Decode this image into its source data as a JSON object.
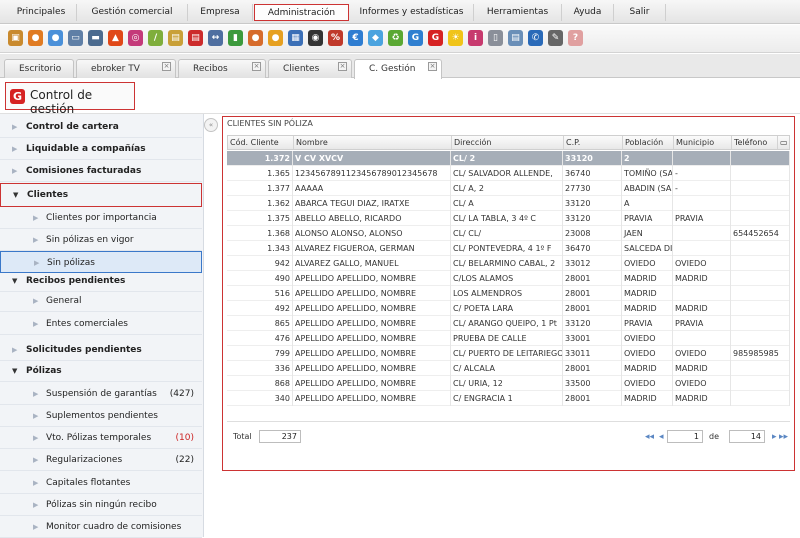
{
  "menu": [
    "Principales",
    "Gestión comercial",
    "Empresa",
    "Administración",
    "Informes y estadísticas",
    "Herramientas",
    "Ayuda",
    "Salir"
  ],
  "tabs": [
    "Escritorio",
    "ebroker TV",
    "Recibos",
    "Clientes",
    "C. Gestión"
  ],
  "page_title": "Control de gestión",
  "sidebar": {
    "items": [
      {
        "label": "Control de cartera"
      },
      {
        "label": "Liquidable a compañías"
      },
      {
        "label": "Comisiones facturadas"
      },
      {
        "label": "Clientes"
      },
      {
        "label": "Clientes por importancia"
      },
      {
        "label": "Sin pólizas en vigor"
      },
      {
        "label": "Sin pólizas"
      },
      {
        "label": "Recibos pendientes"
      },
      {
        "label": "General"
      },
      {
        "label": "Entes comerciales"
      },
      {
        "label": "Solicitudes pendientes"
      },
      {
        "label": "Pólizas"
      },
      {
        "label": "Suspensión de garantías",
        "count": "(427)"
      },
      {
        "label": "Suplementos pendientes"
      },
      {
        "label": "Vto. Pólizas temporales",
        "count": "(10)"
      },
      {
        "label": "Regularizaciones",
        "count": "(22)"
      },
      {
        "label": "Capitales flotantes"
      },
      {
        "label": "Pólizas sin ningún recibo"
      },
      {
        "label": "Monitor cuadro de comisiones"
      }
    ]
  },
  "grid": {
    "title": "CLIENTES SIN PÓLIZA",
    "columns": [
      "Cód. Cliente",
      "Nombre",
      "Dirección",
      "C.P.",
      "Población",
      "Municipio",
      "Teléfono"
    ],
    "rows": [
      [
        "1.372",
        "V CV XVCV",
        "CL/ 2",
        "33120",
        "2",
        "",
        ""
      ],
      [
        "1.365",
        "1234567891123456789012345678",
        "CL/ SALVADOR ALLENDE,",
        "36740",
        "TOMIÑO (SA",
        "-",
        ""
      ],
      [
        "1.377",
        "AAAAA",
        "CL/ A, 2",
        "27730",
        "ABADIN (SA",
        "-",
        ""
      ],
      [
        "1.362",
        "ABARCA TEGUI DIAZ, IRATXE",
        "CL/ A",
        "33120",
        "A",
        "",
        ""
      ],
      [
        "1.375",
        "ABELLO ABELLO, RICARDO",
        "CL/ LA TABLA, 3 4º C",
        "33120",
        "PRAVIA",
        "PRAVIA",
        ""
      ],
      [
        "1.368",
        "ALONSO ALONSO, ALONSO",
        "CL/ CL/",
        "23008",
        "JAEN",
        "",
        "654452654"
      ],
      [
        "1.343",
        "ALVAREZ FIGUEROA, GERMAN",
        "CL/ PONTEVEDRA, 4 1º F",
        "36470",
        "SALCEDA DI",
        "",
        ""
      ],
      [
        "942",
        "ALVAREZ GALLO, MANUEL",
        "CL/ BELARMINO CABAL, 2",
        "33012",
        "OVIEDO",
        "OVIEDO",
        ""
      ],
      [
        "490",
        "APELLIDO APELLIDO, NOMBRE",
        "C/LOS ALAMOS",
        "28001",
        "MADRID",
        "MADRID",
        ""
      ],
      [
        "516",
        "APELLIDO APELLIDO, NOMBRE",
        "LOS ALMENDROS",
        "28001",
        "MADRID",
        "",
        ""
      ],
      [
        "492",
        "APELLIDO APELLIDO, NOMBRE",
        "C/ POETA LARA",
        "28001",
        "MADRID",
        "MADRID",
        ""
      ],
      [
        "865",
        "APELLIDO APELLIDO, NOMBRE",
        "CL/ ARANGO QUEIPO, 1 Pt",
        "33120",
        "PRAVIA",
        "PRAVIA",
        ""
      ],
      [
        "476",
        "APELLIDO APELLIDO, NOMBRE",
        "PRUEBA DE CALLE",
        "33001",
        "OVIEDO",
        "",
        ""
      ],
      [
        "799",
        "APELLIDO APELLIDO, NOMBRE",
        "CL/ PUERTO DE LEITARIEGO",
        "33011",
        "OVIEDO",
        "OVIEDO",
        "985985985"
      ],
      [
        "336",
        "APELLIDO APELLIDO, NOMBRE",
        "C/ ALCALA",
        "28001",
        "MADRID",
        "MADRID",
        ""
      ],
      [
        "868",
        "APELLIDO APELLIDO, NOMBRE",
        "CL/ URIA, 12",
        "33500",
        "OVIEDO",
        "OVIEDO",
        ""
      ],
      [
        "340",
        "APELLIDO APELLIDO, NOMBRE",
        "C/ ENGRACIA 1",
        "28001",
        "MADRID",
        "MADRID",
        ""
      ]
    ],
    "total_label": "Total",
    "total_value": "237",
    "page_current": "1",
    "page_of_label": "de",
    "page_total": "14"
  }
}
